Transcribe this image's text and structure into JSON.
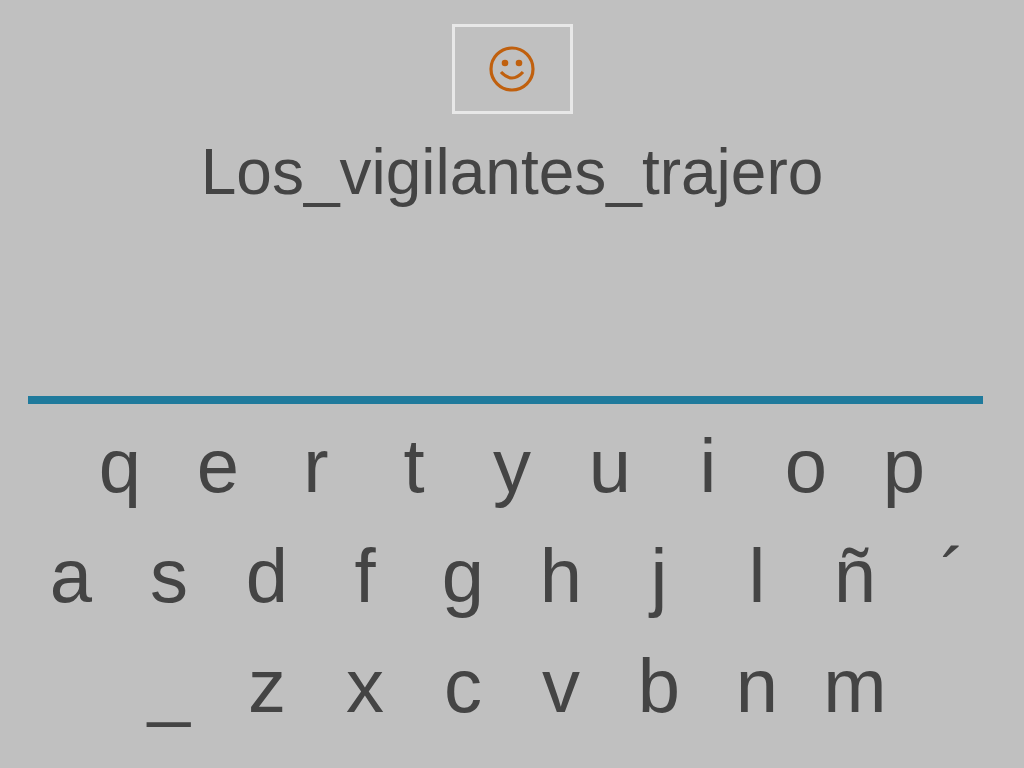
{
  "word": "Los_vigilantes_trajero",
  "keyboard": [
    [
      "q",
      "e",
      "r",
      "t",
      "y",
      "u",
      "i",
      "o",
      "p"
    ],
    [
      "a",
      "s",
      "d",
      "f",
      "g",
      "h",
      "j",
      "l",
      "ñ",
      "´"
    ],
    [
      "_",
      "z",
      "x",
      "c",
      "v",
      "b",
      "n",
      "m"
    ]
  ]
}
